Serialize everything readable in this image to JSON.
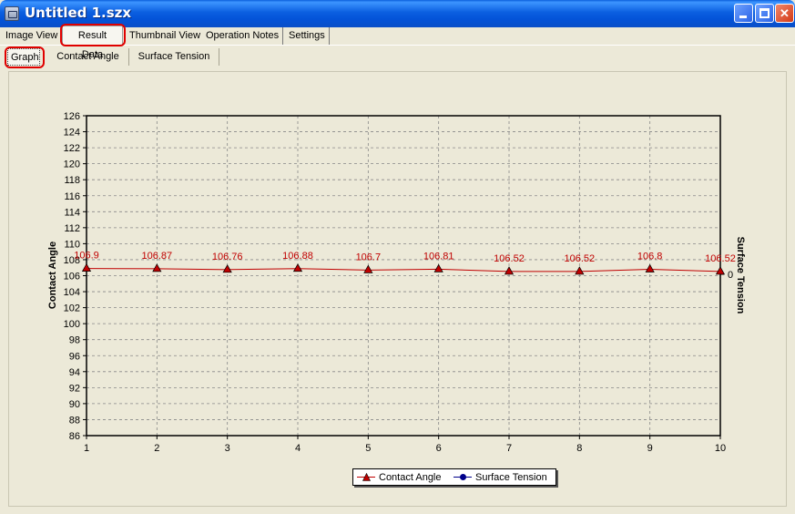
{
  "window": {
    "title": "Untitled 1.szx",
    "minimize_icon": "minimize-icon",
    "maximize_icon": "maximize-icon",
    "close_icon": "close-icon"
  },
  "tabs": [
    {
      "label": "Image View",
      "active": false
    },
    {
      "label": "Result Data",
      "active": true
    },
    {
      "label": "Thumbnail View",
      "active": false
    },
    {
      "label": "Operation Notes",
      "active": false
    },
    {
      "label": "Settings",
      "active": false
    }
  ],
  "subtabs": [
    {
      "label": "Graph",
      "active": true
    },
    {
      "label": "Contact Angle",
      "active": false
    },
    {
      "label": "Surface Tension",
      "active": false
    }
  ],
  "chart_data": {
    "type": "line",
    "x": [
      1,
      2,
      3,
      4,
      5,
      6,
      7,
      8,
      9,
      10
    ],
    "x_tick_labels": [
      "1",
      "2",
      "3",
      "4",
      "5",
      "6",
      "7",
      "8",
      "9",
      "10"
    ],
    "series": [
      {
        "name": "Contact Angle",
        "axis": "left",
        "color": "#c00000",
        "marker": "triangle",
        "values": [
          106.9,
          106.87,
          106.76,
          106.88,
          106.7,
          106.81,
          106.52,
          106.52,
          106.8,
          106.52
        ],
        "data_labels": [
          "106.9",
          "106.87",
          "106.76",
          "106.88",
          "106.7",
          "106.81",
          "106.52",
          "106.52",
          "106.8",
          "106.52"
        ]
      },
      {
        "name": "Surface Tension",
        "axis": "right",
        "color": "#00008b",
        "marker": "circle",
        "values": []
      }
    ],
    "ylabel": "Contact Angle",
    "ylabel_right": "Surface Tension",
    "ylim": [
      86,
      126
    ],
    "y_ticks": [
      "86",
      "88",
      "90",
      "92",
      "94",
      "96",
      "98",
      "100",
      "102",
      "104",
      "106",
      "108",
      "110",
      "112",
      "114",
      "116",
      "118",
      "120",
      "122",
      "124",
      "126"
    ],
    "y_right_ticks": [
      "0"
    ],
    "xlim": [
      1,
      10
    ],
    "grid": true,
    "legend_position": "bottom-center"
  }
}
